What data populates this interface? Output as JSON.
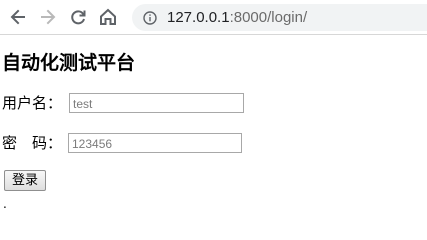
{
  "browser": {
    "url_host": "127.0.0.1",
    "url_rest": ":8000/login/",
    "icons": {
      "back": "arrow-left-icon",
      "forward": "arrow-right-icon",
      "reload": "reload-icon",
      "home": "home-icon",
      "info": "info-icon"
    }
  },
  "page": {
    "title": "自动化测试平台",
    "username_label": "用户名：",
    "username_placeholder": "test",
    "password_label": "密　码：",
    "password_placeholder": "123456",
    "login_button": "登录",
    "stray_text": "."
  }
}
